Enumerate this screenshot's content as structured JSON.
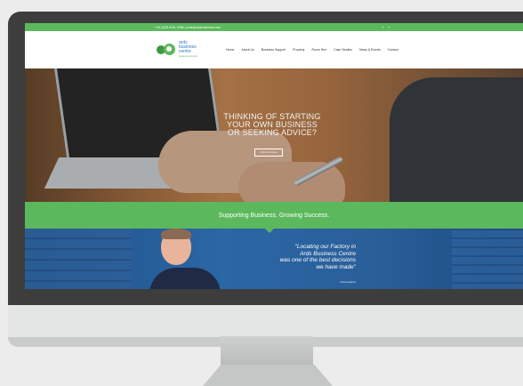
{
  "topbar": {
    "contact": "+44 (0)28 9181 9286  |  ards@ardsbusiness.com",
    "social": [
      "f",
      "t"
    ]
  },
  "logo": {
    "line1": "ards",
    "line2": "business",
    "line3": "centre",
    "tagline": "business centre"
  },
  "nav": [
    "Home",
    "About Us",
    "Business Support",
    "Property",
    "Room Hire",
    "Case Studies",
    "News & Events",
    "Contact"
  ],
  "hero": {
    "headline_line1": "THINKING OF STARTING",
    "headline_line2": "YOUR OWN BUSINESS",
    "headline_line3": "OR SEEKING ADVICE?",
    "button": "Find out more"
  },
  "band": {
    "text": "Supporting Business. Growing Success."
  },
  "testimonial": {
    "quote_line1": "\"Locating our Factory in",
    "quote_line2": "Ards Business Centre",
    "quote_line3": "was one of the best decisions",
    "quote_line4": "we have made\"",
    "author": "Paul Hopkins"
  },
  "colors": {
    "accent_green": "#5cb85c",
    "bezel": "#3d3d3d",
    "blue": "#2b67a5"
  }
}
